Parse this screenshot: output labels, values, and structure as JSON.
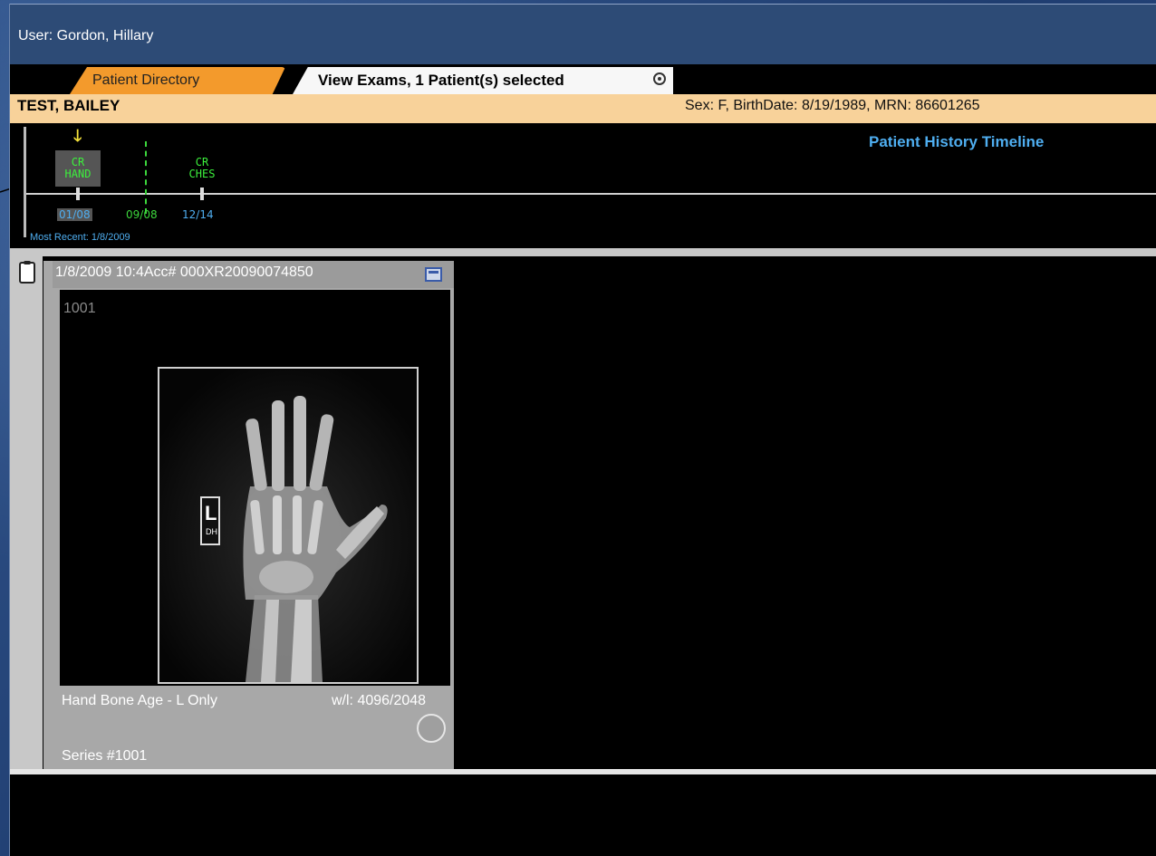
{
  "user_bar": {
    "label": "User: Gordon, Hillary"
  },
  "tabs": [
    {
      "label": "Patient Directory",
      "active": false
    },
    {
      "label": "View Exams, 1 Patient(s) selected",
      "active": true
    }
  ],
  "patient": {
    "name": "TEST, BAILEY",
    "info": "Sex: F, BirthDate: 8/19/1989, MRN: 86601265"
  },
  "timeline": {
    "title": "Patient History Timeline",
    "exams": [
      {
        "line1": "CR",
        "line2": "HAND",
        "date": "01/08",
        "color": "#3cf03c",
        "date_color": "#4faef0",
        "selected": true
      },
      {
        "line1": "CR",
        "line2": "CHES",
        "date": "12/14",
        "color": "#3cf03c",
        "date_color": "#4faef0",
        "selected": false
      }
    ],
    "marker_date": "09/08",
    "marker_color": "#3cd63c",
    "most_recent": "Most Recent: 1/8/2009"
  },
  "series_card": {
    "header": "1/8/2009 10:4",
    "header_acc": "Acc# 000XR20090074850",
    "image_number": "1001",
    "description": "Hand Bone Age - L Only",
    "window_level": "w/l: 4096/2048",
    "series": "Series #1001",
    "marker_text_top": "L",
    "marker_text_bottom": "DH"
  },
  "colors": {
    "accent_orange": "#f39a2c",
    "header_blue": "#2d4b76",
    "timeline_blue": "#4faef0",
    "exam_green": "#3cf03c"
  }
}
